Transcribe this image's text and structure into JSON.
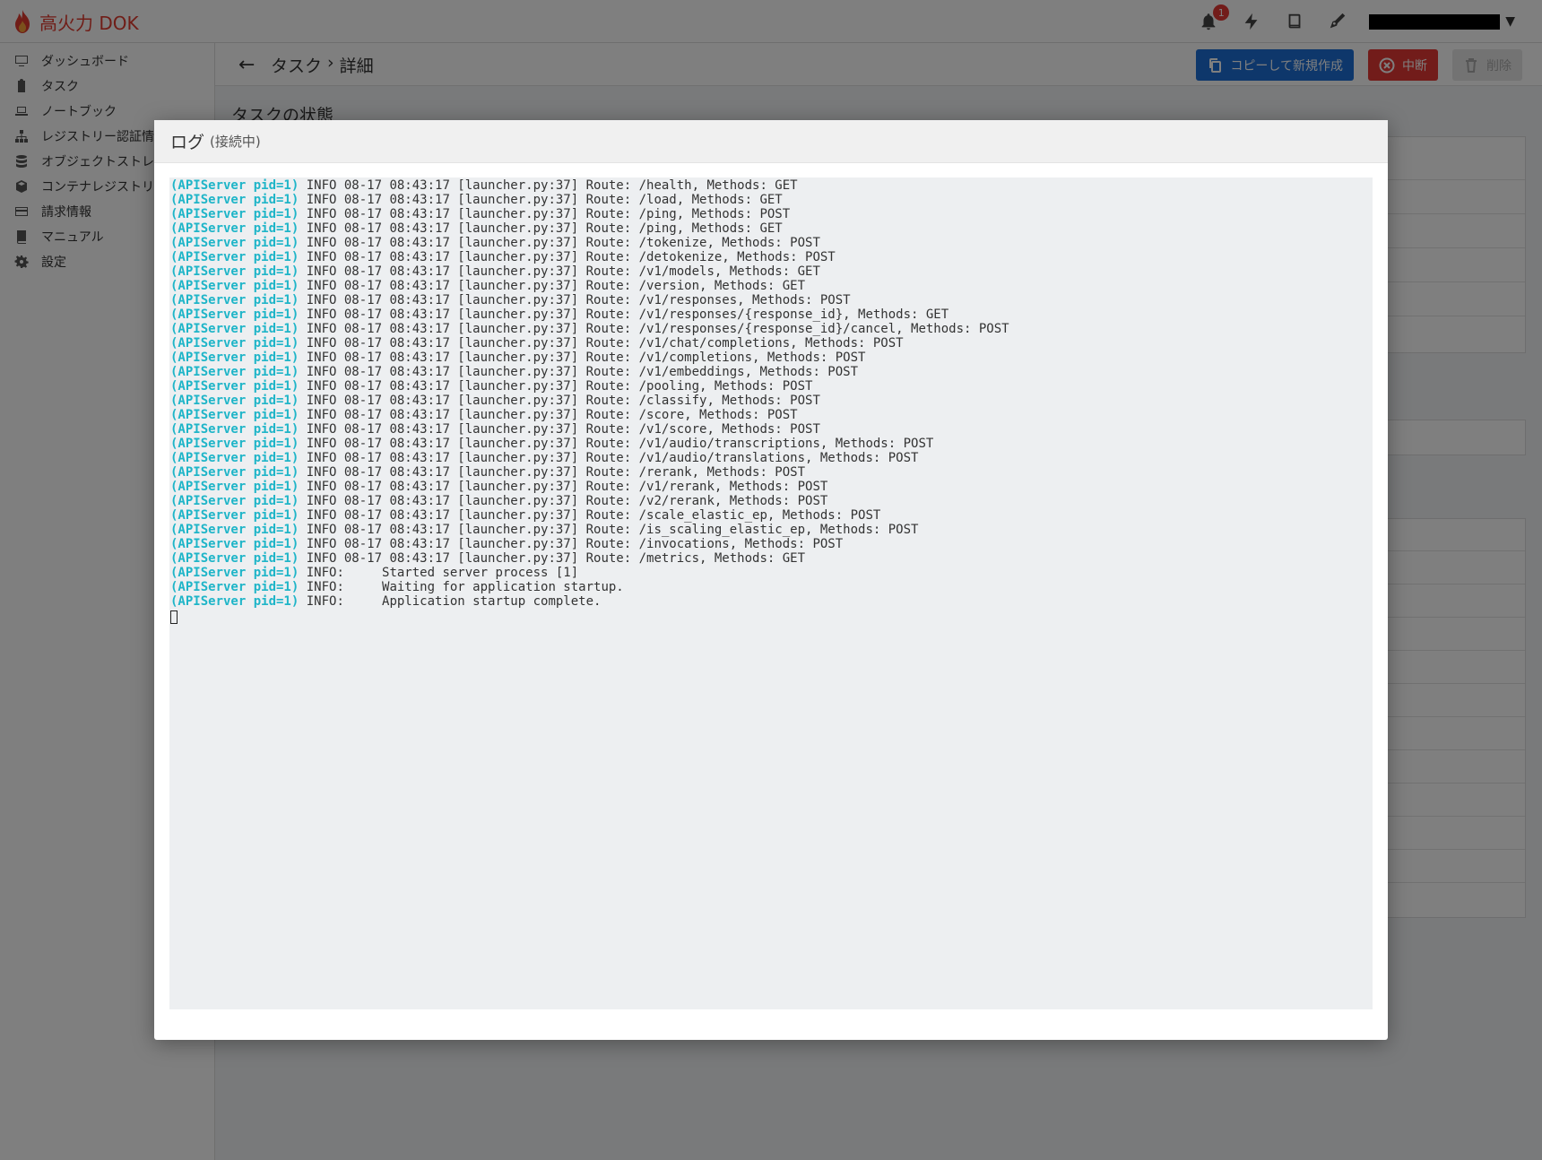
{
  "app": {
    "brand": "高火力 DOK"
  },
  "topbar": {
    "notification_count": "1",
    "icons": [
      "bell-icon",
      "bolt-icon",
      "book-icon",
      "pen-icon"
    ]
  },
  "sidebar": {
    "items": [
      {
        "label": "ダッシュボード",
        "icon": "monitor-icon"
      },
      {
        "label": "タスク",
        "icon": "clipboard-icon"
      },
      {
        "label": "ノートブック",
        "icon": "laptop-icon"
      },
      {
        "label": "レジストリー認証情報",
        "icon": "sitemap-icon"
      },
      {
        "label": "オブジェクトストレージ",
        "icon": "database-icon"
      },
      {
        "label": "コンテナレジストリ",
        "icon": "cube-icon"
      },
      {
        "label": "請求情報",
        "icon": "credit-card-icon"
      },
      {
        "label": "マニュアル",
        "icon": "book-icon"
      },
      {
        "label": "設定",
        "icon": "gear-icon"
      }
    ]
  },
  "header": {
    "breadcrumb_parent": "タスク",
    "breadcrumb_sep": "›",
    "breadcrumb_current": "詳細",
    "copy_button": "コピーして新規作成",
    "stop_button": "中断",
    "delete_button": "削除"
  },
  "main": {
    "section_title": "タスクの状態"
  },
  "modal": {
    "title": "ログ",
    "status": "(接続中)",
    "log_lines": [
      {
        "prefix": "(APIServer pid=1)",
        "text": " INFO 08-17 08:43:17 [launcher.py:37] Route: /health, Methods: GET"
      },
      {
        "prefix": "(APIServer pid=1)",
        "text": " INFO 08-17 08:43:17 [launcher.py:37] Route: /load, Methods: GET"
      },
      {
        "prefix": "(APIServer pid=1)",
        "text": " INFO 08-17 08:43:17 [launcher.py:37] Route: /ping, Methods: POST"
      },
      {
        "prefix": "(APIServer pid=1)",
        "text": " INFO 08-17 08:43:17 [launcher.py:37] Route: /ping, Methods: GET"
      },
      {
        "prefix": "(APIServer pid=1)",
        "text": " INFO 08-17 08:43:17 [launcher.py:37] Route: /tokenize, Methods: POST"
      },
      {
        "prefix": "(APIServer pid=1)",
        "text": " INFO 08-17 08:43:17 [launcher.py:37] Route: /detokenize, Methods: POST"
      },
      {
        "prefix": "(APIServer pid=1)",
        "text": " INFO 08-17 08:43:17 [launcher.py:37] Route: /v1/models, Methods: GET"
      },
      {
        "prefix": "(APIServer pid=1)",
        "text": " INFO 08-17 08:43:17 [launcher.py:37] Route: /version, Methods: GET"
      },
      {
        "prefix": "(APIServer pid=1)",
        "text": " INFO 08-17 08:43:17 [launcher.py:37] Route: /v1/responses, Methods: POST"
      },
      {
        "prefix": "(APIServer pid=1)",
        "text": " INFO 08-17 08:43:17 [launcher.py:37] Route: /v1/responses/{response_id}, Methods: GET"
      },
      {
        "prefix": "(APIServer pid=1)",
        "text": " INFO 08-17 08:43:17 [launcher.py:37] Route: /v1/responses/{response_id}/cancel, Methods: POST"
      },
      {
        "prefix": "(APIServer pid=1)",
        "text": " INFO 08-17 08:43:17 [launcher.py:37] Route: /v1/chat/completions, Methods: POST"
      },
      {
        "prefix": "(APIServer pid=1)",
        "text": " INFO 08-17 08:43:17 [launcher.py:37] Route: /v1/completions, Methods: POST"
      },
      {
        "prefix": "(APIServer pid=1)",
        "text": " INFO 08-17 08:43:17 [launcher.py:37] Route: /v1/embeddings, Methods: POST"
      },
      {
        "prefix": "(APIServer pid=1)",
        "text": " INFO 08-17 08:43:17 [launcher.py:37] Route: /pooling, Methods: POST"
      },
      {
        "prefix": "(APIServer pid=1)",
        "text": " INFO 08-17 08:43:17 [launcher.py:37] Route: /classify, Methods: POST"
      },
      {
        "prefix": "(APIServer pid=1)",
        "text": " INFO 08-17 08:43:17 [launcher.py:37] Route: /score, Methods: POST"
      },
      {
        "prefix": "(APIServer pid=1)",
        "text": " INFO 08-17 08:43:17 [launcher.py:37] Route: /v1/score, Methods: POST"
      },
      {
        "prefix": "(APIServer pid=1)",
        "text": " INFO 08-17 08:43:17 [launcher.py:37] Route: /v1/audio/transcriptions, Methods: POST"
      },
      {
        "prefix": "(APIServer pid=1)",
        "text": " INFO 08-17 08:43:17 [launcher.py:37] Route: /v1/audio/translations, Methods: POST"
      },
      {
        "prefix": "(APIServer pid=1)",
        "text": " INFO 08-17 08:43:17 [launcher.py:37] Route: /rerank, Methods: POST"
      },
      {
        "prefix": "(APIServer pid=1)",
        "text": " INFO 08-17 08:43:17 [launcher.py:37] Route: /v1/rerank, Methods: POST"
      },
      {
        "prefix": "(APIServer pid=1)",
        "text": " INFO 08-17 08:43:17 [launcher.py:37] Route: /v2/rerank, Methods: POST"
      },
      {
        "prefix": "(APIServer pid=1)",
        "text": " INFO 08-17 08:43:17 [launcher.py:37] Route: /scale_elastic_ep, Methods: POST"
      },
      {
        "prefix": "(APIServer pid=1)",
        "text": " INFO 08-17 08:43:17 [launcher.py:37] Route: /is_scaling_elastic_ep, Methods: POST"
      },
      {
        "prefix": "(APIServer pid=1)",
        "text": " INFO 08-17 08:43:17 [launcher.py:37] Route: /invocations, Methods: POST"
      },
      {
        "prefix": "(APIServer pid=1)",
        "text": " INFO 08-17 08:43:17 [launcher.py:37] Route: /metrics, Methods: GET"
      },
      {
        "prefix": "(APIServer pid=1)",
        "text": " INFO:     Started server process [1]"
      },
      {
        "prefix": "(APIServer pid=1)",
        "text": " INFO:     Waiting for application startup."
      },
      {
        "prefix": "(APIServer pid=1)",
        "text": " INFO:     Application startup complete."
      }
    ]
  },
  "colors": {
    "brand": "#e03a2f",
    "log_prefix": "#1fb5c8",
    "primary": "#1d6fd6",
    "danger": "#e53935"
  }
}
